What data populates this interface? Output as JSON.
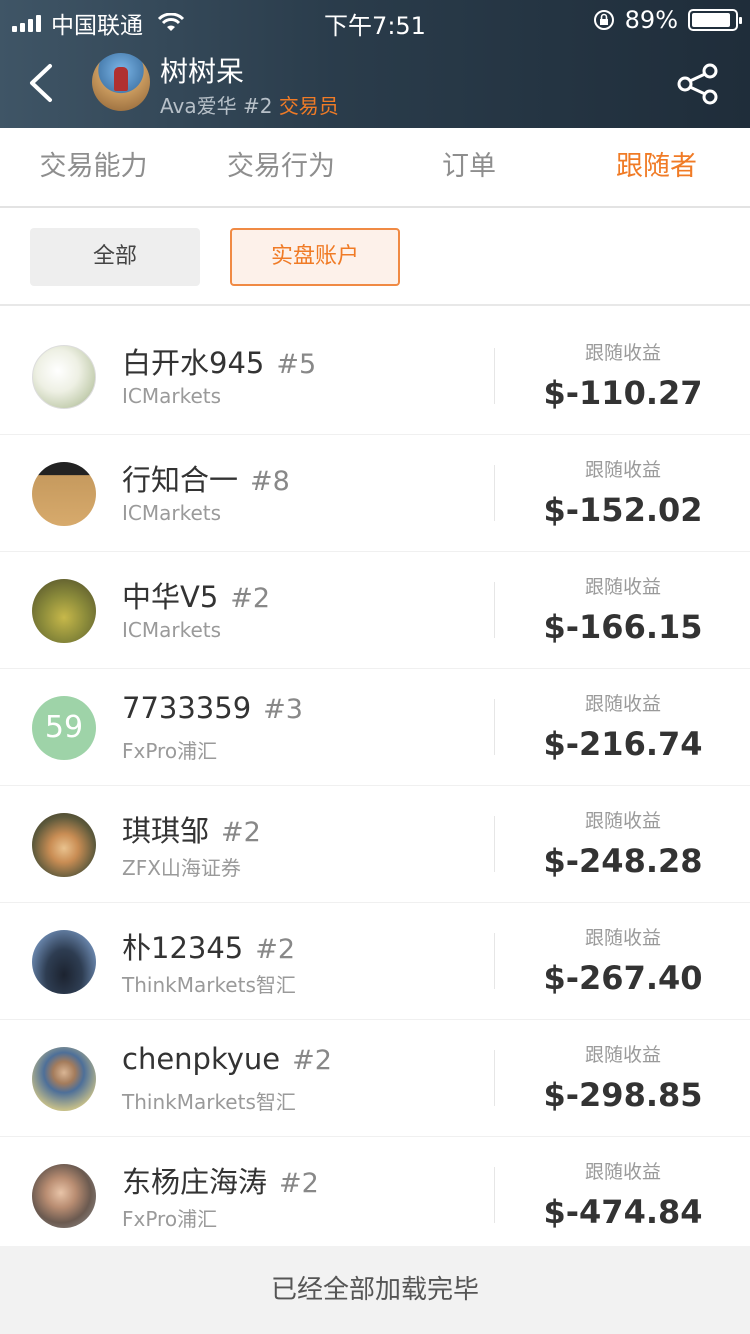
{
  "statusbar": {
    "carrier": "中国联通",
    "time": "下午7:51",
    "battery": "89%",
    "battery_level": 0.89,
    "signal_bars": 4,
    "icons": [
      "signal-icon",
      "wifi-icon",
      "rotation-lock-icon",
      "battery-icon"
    ]
  },
  "header": {
    "name": "树树呆",
    "subtitle_user": "Ava爱华",
    "subtitle_rank": "#2",
    "subtitle_role": "交易员",
    "icons": [
      "back-icon",
      "share-icon"
    ]
  },
  "tabs": [
    {
      "label": "交易能力",
      "active": false
    },
    {
      "label": "交易行为",
      "active": false
    },
    {
      "label": "订单",
      "active": false
    },
    {
      "label": "跟随者",
      "active": true
    }
  ],
  "filters": [
    {
      "label": "全部",
      "selected": false
    },
    {
      "label": "实盘账户",
      "selected": true
    }
  ],
  "followers": [
    {
      "name": "白开水945",
      "rank": "#5",
      "broker": "ICMarkets",
      "return_label": "跟随收益",
      "return_value": "$-110.27"
    },
    {
      "name": "行知合一",
      "rank": "#8",
      "broker": "ICMarkets",
      "return_label": "跟随收益",
      "return_value": "$-152.02"
    },
    {
      "name": "中华V5",
      "rank": "#2",
      "broker": "ICMarkets",
      "return_label": "跟随收益",
      "return_value": "$-166.15"
    },
    {
      "name": "7733359",
      "rank": "#3",
      "broker": "FxPro浦汇",
      "return_label": "跟随收益",
      "return_value": "$-216.74",
      "avatar_text": "59"
    },
    {
      "name": "琪琪邹",
      "rank": "#2",
      "broker": "ZFX山海证券",
      "return_label": "跟随收益",
      "return_value": "$-248.28"
    },
    {
      "name": "朴12345",
      "rank": "#2",
      "broker": "ThinkMarkets智汇",
      "return_label": "跟随收益",
      "return_value": "$-267.40"
    },
    {
      "name": "chenpkyue",
      "rank": "#2",
      "broker": "ThinkMarkets智汇",
      "return_label": "跟随收益",
      "return_value": "$-298.85"
    },
    {
      "name": "东杨庄海涛",
      "rank": "#2",
      "broker": "FxPro浦汇",
      "return_label": "跟随收益",
      "return_value": "$-474.84"
    }
  ],
  "footer": {
    "text": "已经全部加载完毕"
  },
  "colors": {
    "accent": "#f07b26",
    "header_bg": "#2a3c4b",
    "footer_bg": "#f2f2f2"
  }
}
